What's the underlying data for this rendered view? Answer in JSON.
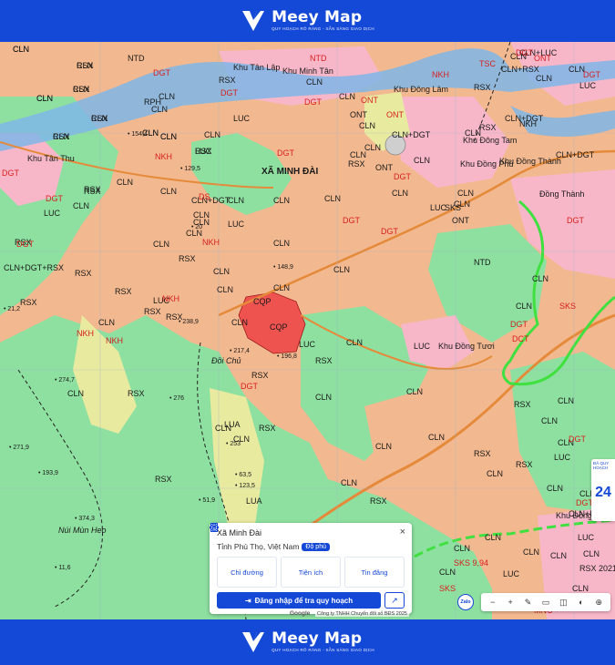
{
  "brand": {
    "name": "Meey Map",
    "tagline": "QUY HOẠCH RÕ RÀNG - SẴN SÀNG GIAO DỊCH"
  },
  "map": {
    "place_labels": [
      {
        "text": "XÃ MINH ĐÀI",
        "style": "bold"
      },
      {
        "text": "Khu Tân Lập"
      },
      {
        "text": "Khu Minh Tân"
      },
      {
        "text": "Khu Đông Lâm"
      },
      {
        "text": "Khu Đông Tam"
      },
      {
        "text": "Khu Đồng Thành"
      },
      {
        "text": "Khu Đồng Phú"
      },
      {
        "text": "Đồng Thành"
      },
      {
        "text": "Khu Đồng Tươi"
      },
      {
        "text": "Khu Đồng Bào"
      },
      {
        "text": "Khu Tân Thu"
      },
      {
        "text": "Đồi Chủ",
        "style": "italic"
      },
      {
        "text": "Núi Mùn Heo",
        "style": "italic"
      }
    ],
    "zone_labels": [
      "CLN",
      "CLN",
      "RSX",
      "CLN",
      "CLN",
      "RSX",
      "CLN",
      "LUC",
      "CLN",
      "NTD",
      "CLN",
      "RSX",
      "CLN",
      "CLN",
      "ONT",
      "RPH",
      "CLN",
      "LUC",
      "CLN",
      "CLN",
      "CLN+DGT",
      "CLN",
      "CLN",
      "CLN",
      "LUC",
      "CLN",
      "RSX",
      "CLN",
      "CLN",
      "CLN+LUC",
      "CLN+RSX",
      "CLN",
      "RSX",
      "CLN",
      "CLN+DGT+RSX",
      "CLN",
      "CLN",
      "RSX",
      "CLN",
      "RSX",
      "CLN",
      "ONT",
      "RSX",
      "RSX",
      "CLN",
      "RSX",
      "CLN",
      "LUC",
      "CLN",
      "CLN",
      "CLN",
      "LUC",
      "RSX",
      "RSX",
      "LUC",
      "RSX",
      "CLN",
      "RSX",
      "RSX",
      "CLN",
      "CLN",
      "RSX",
      "CLN",
      "LUC",
      "CLN",
      "CLN",
      "CLN",
      "CLN",
      "LUA",
      "RSX",
      "LUA",
      "RSX",
      "CLN",
      "RSX",
      "CLN",
      "RSX",
      "CLN",
      "LUC",
      "CLN",
      "CLN",
      "CLN",
      "RSX",
      "RSX",
      "CLN",
      "CLN",
      "CLN",
      "LUC",
      "RSX",
      "CLN",
      "CLN",
      "CLN",
      "NKH",
      "ONT",
      "CLN",
      "CLN+DGT",
      "CLN",
      "RSX",
      "CLN+DGT",
      "CLN+DGT",
      "CLN",
      "LUC",
      "SKS",
      "NTD",
      "CLN",
      "CLN",
      "CLN",
      "CLN",
      "CLN+LUC",
      "CLN",
      "CLN",
      "CLN",
      "CLN",
      "RSX 2021",
      "CLN",
      "LUC",
      "LUC",
      "CLN",
      "CLN",
      "CLN",
      "CLN",
      "RSX",
      "CLN",
      "CLN",
      "RSX",
      "CLN",
      "CLN",
      "RSX",
      "CLN"
    ],
    "red_labels": [
      "NTD",
      "DGT",
      "DGT",
      "DGT",
      "ONT",
      "ONT",
      "NKH",
      "DGT",
      "DGT",
      "DGT",
      "DS",
      "NKH",
      "DGT",
      "NKH",
      "NKH",
      "NKH",
      "DGT",
      "DGT",
      "DGT",
      "DGT",
      "SKS",
      "DGT",
      "DGT",
      "ONT",
      "DGT",
      "DGT",
      "DGT",
      "DCT",
      "SKS 9,94",
      "SKS",
      "DGT",
      "MNC",
      "NKH",
      "TSC"
    ],
    "cqp_labels": [
      "CQP",
      "CQP"
    ],
    "heights": [
      "154,4",
      "129,5",
      "148,9",
      "238,9",
      "217,4",
      "196,8",
      "274,7",
      "276",
      "271,9",
      "253",
      "193,9",
      "123,5",
      "63,5",
      "51,9",
      "374,3",
      "11,6",
      "21,2",
      "20"
    ]
  },
  "popup": {
    "title": "Xã Minh Đài",
    "subtitle": "Tỉnh Phú Thọ, Việt Nam",
    "badge": "Độ phủ",
    "close": "×",
    "actions": [
      {
        "label": "Chỉ đường",
        "icon": "directions-icon"
      },
      {
        "label": "Tiện ích",
        "icon": "utilities-icon"
      },
      {
        "label": "Tin đăng",
        "icon": "listing-icon"
      }
    ],
    "login_label": "Đăng nhập để tra quy hoạch",
    "share_glyph": "↗"
  },
  "attribution": {
    "google": "Google",
    "credit": "Công ty TNHH Chuyển đổi số BĐS 2025"
  },
  "zalo_label": "Zalo",
  "toolbar": [
    "−",
    "+",
    "✎",
    "▭",
    "◫",
    "◐",
    "⊕"
  ],
  "side_card": {
    "top": "ĐÃ QUY HOẠCH",
    "number": "24"
  },
  "colors": {
    "brand_blue": "#1448d6",
    "cln_orange": "#f2b88f",
    "rsx_green": "#8ee0a0",
    "residential_pink": "#f7b7c8",
    "cqp_red": "#ef5350",
    "river": "#7fb6e8"
  }
}
